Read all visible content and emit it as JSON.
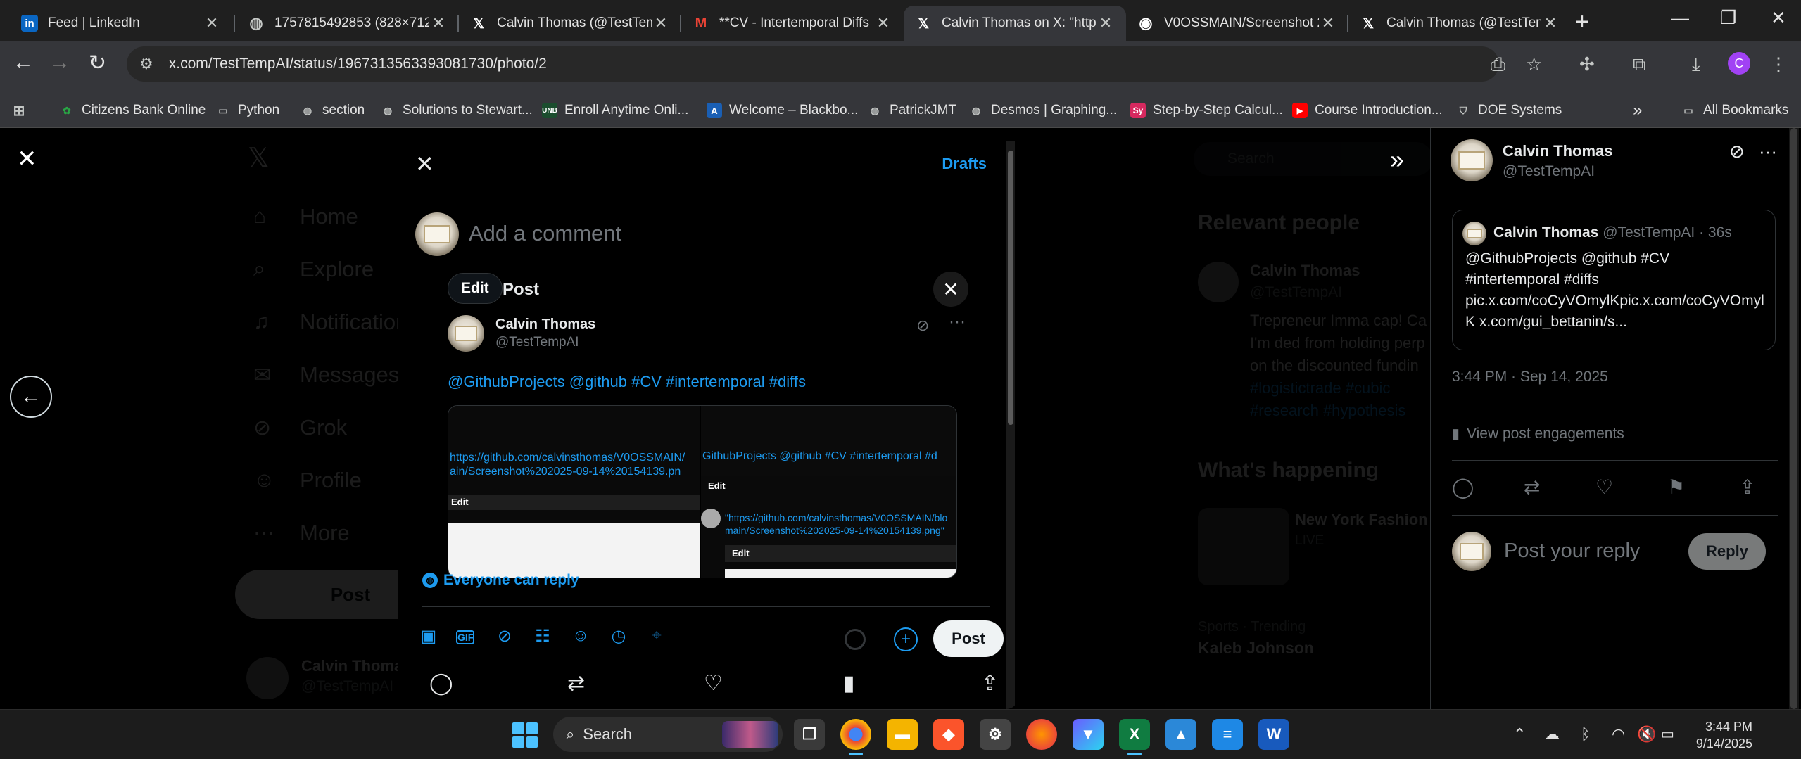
{
  "browser": {
    "tabs": [
      {
        "title": "Feed | LinkedIn",
        "icon": "linkedin-icon",
        "fav": "in",
        "fav_bg": "#0a66c2"
      },
      {
        "title": "1757815492853 (828×712)",
        "icon": "globe-icon",
        "fav": "◍",
        "fav_bg": "transparent"
      },
      {
        "title": "Calvin Thomas (@TestTempAI)",
        "icon": "x-logo-icon",
        "fav": "𝕏",
        "fav_bg": "transparent"
      },
      {
        "title": "**CV - Intertemporal Diffs",
        "icon": "gmail-icon",
        "fav": "M",
        "fav_bg": "transparent"
      },
      {
        "title": "Calvin Thomas on X: \"https",
        "icon": "x-logo-icon",
        "fav": "𝕏",
        "fav_bg": "transparent"
      },
      {
        "title": "V0OSSMAIN/Screenshot 2",
        "icon": "github-icon",
        "fav": "◉",
        "fav_bg": "transparent"
      },
      {
        "title": "Calvin Thomas (@TestTempAI)",
        "icon": "x-logo-icon",
        "fav": "𝕏",
        "fav_bg": "transparent"
      }
    ],
    "active_tab_index": 4,
    "url": "x.com/TestTempAI/status/1967313563393081730/photo/2",
    "bookmarks": [
      {
        "label": "Citizens Bank Online",
        "icon": "citizens-bank-icon"
      },
      {
        "label": "Python",
        "icon": "folder-icon"
      },
      {
        "label": "section",
        "icon": "globe-icon"
      },
      {
        "label": "Solutions to Stewart...",
        "icon": "globe-icon"
      },
      {
        "label": "Enroll Anytime Onli...",
        "icon": "unb-icon"
      },
      {
        "label": "Welcome – Blackbo...",
        "icon": "blackboard-icon"
      },
      {
        "label": "PatrickJMT",
        "icon": "globe-icon"
      },
      {
        "label": "Desmos | Graphing...",
        "icon": "globe-icon"
      },
      {
        "label": "Step-by-Step Calcul...",
        "icon": "symbolab-icon"
      },
      {
        "label": "Course Introduction...",
        "icon": "youtube-icon"
      },
      {
        "label": "DOE Systems",
        "icon": "doe-icon"
      }
    ],
    "all_bookmarks": "All Bookmarks"
  },
  "x_background": {
    "nav": [
      "Home",
      "Explore",
      "Notifications",
      "Messages",
      "Grok",
      "Profile",
      "More"
    ],
    "post_button": "Post",
    "account_name": "Calvin Thomas",
    "account_handle": "@TestTempAI",
    "relevant_people_title": "Relevant people",
    "relevant_name": "Calvin Thomas",
    "relevant_handle": "@TestTempAI",
    "relevant_bio": "Trepreneur Imma cap! Ca I'm ded from holding perp on the discounted fundin",
    "relevant_tags": "#logistictrade #cubic #research #hypothesis",
    "whats_happening_title": "What's happening",
    "trend_title": "New York Fashion",
    "trend_sub": "LIVE",
    "trend2_label": "Sports · Trending",
    "trend2_title": "Kaleb Johnson",
    "search_placeholder": "Search",
    "header_post": "Post"
  },
  "composer": {
    "drafts": "Drafts",
    "placeholder": "Add a comment",
    "edit": "Edit",
    "quote_header": "Post",
    "quoted_name": "Calvin Thomas",
    "quoted_handle": "@TestTempAI",
    "quoted_text": "@GithubProjects @github #CV #intertemporal #diffs",
    "media1_link": "https://github.com/calvinsthomas/V0OSSMAIN/\nain/Screenshot%202025-09-14%20154139.pn",
    "media1_edit": "Edit",
    "media2_header_text": "GithubProjects @github #CV #intertemporal #d",
    "media2_edit": "Edit",
    "media2_link": "\"https://github.com/calvinsthomas/V0OSSMAIN/blo\nmain/Screenshot%202025-09-14%20154139.png\"",
    "media2_edit2": "Edit",
    "reply_setting": "Everyone can reply",
    "post_button": "Post",
    "tools": [
      "image-icon",
      "gif-icon",
      "grok-icon",
      "poll-icon",
      "emoji-icon",
      "schedule-icon",
      "location-icon"
    ]
  },
  "right_panel": {
    "name": "Calvin Thomas",
    "handle": "@TestTempAI",
    "quoted": {
      "name": "Calvin Thomas",
      "handle_time": "@TestTempAI · 36s",
      "text": "@GithubProjects @github #CV #intertemporal #diffs pic.x.com/coCyVOmylKpic.x.com/coCyVOmylK x.com/gui_bettanin/s..."
    },
    "timestamp": "3:44 PM · Sep 14, 2025",
    "engagements": "View post engagements",
    "reply_placeholder": "Post your reply",
    "reply_button": "Reply"
  },
  "taskbar": {
    "search": "Search",
    "time": "3:44 PM",
    "date": "9/14/2025"
  },
  "colors": {
    "accent": "#1d9bf0",
    "chrome_active_tab": "#35363a",
    "chrome_tabstrip": "#1f1f1f"
  }
}
